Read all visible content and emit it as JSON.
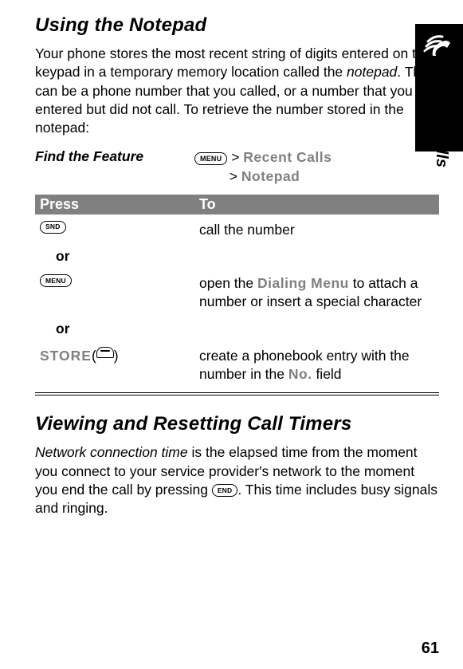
{
  "side": {
    "section": "Recent Calls"
  },
  "page_number": "61",
  "h1a": "Using the Notepad",
  "intro_a_pre": "Your phone stores the most recent string of digits entered on the keypad in a temporary memory location called the ",
  "intro_a_em": "notepad",
  "intro_a_post": ". This can be a phone number that you called, or a number that you entered but did not call. To retrieve the number stored in the notepad:",
  "feature": {
    "label": "Find the Feature",
    "key1": "MENU",
    "gt1": ">",
    "path1": "Recent Calls",
    "gt2": ">",
    "path2": "Notepad"
  },
  "table": {
    "h_press": "Press",
    "h_to": "To",
    "r1_key": "SND",
    "r1_to": "call the number",
    "or": "or",
    "r2_key": "MENU",
    "r2_to_pre": "open the ",
    "r2_to_menu": "Dialing Menu",
    "r2_to_post": " to attach a number or insert a special character",
    "r3_store": "STORE",
    "r3_paren_o": " (",
    "r3_paren_c": ")",
    "r3_to_pre": "create a phonebook entry with the number in the ",
    "r3_to_menu": "No.",
    "r3_to_post": " field"
  },
  "h1b": "Viewing and Resetting Call Timers",
  "intro_b_em": "Network connection time",
  "intro_b_mid": " is the elapsed time from the moment you connect to your service provider's network to the moment you end the call by pressing ",
  "intro_b_key": "END",
  "intro_b_post": ". This time includes busy signals and ringing."
}
